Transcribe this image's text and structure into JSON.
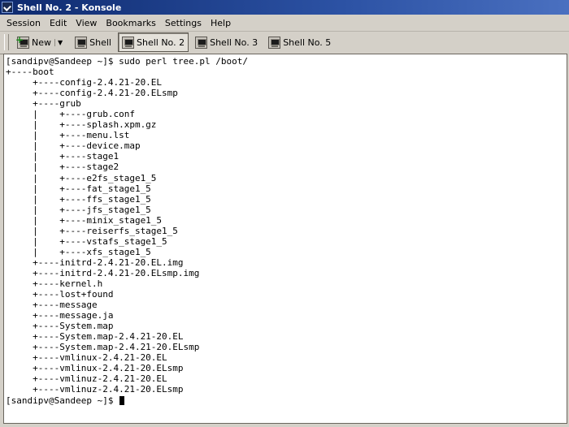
{
  "window": {
    "title": "Shell No. 2 - Konsole"
  },
  "menubar": [
    "Session",
    "Edit",
    "View",
    "Bookmarks",
    "Settings",
    "Help"
  ],
  "toolbar": {
    "new_label": "New",
    "tabs": [
      {
        "label": "Shell",
        "active": false
      },
      {
        "label": "Shell No. 2",
        "active": true
      },
      {
        "label": "Shell No. 3",
        "active": false
      },
      {
        "label": "Shell No. 5",
        "active": false
      }
    ]
  },
  "terminal": {
    "lines": [
      "[sandipv@Sandeep ~]$ sudo perl tree.pl /boot/",
      "+----boot",
      "     +----config-2.4.21-20.EL",
      "     +----config-2.4.21-20.ELsmp",
      "     +----grub",
      "     |    +----grub.conf",
      "     |    +----splash.xpm.gz",
      "     |    +----menu.lst",
      "     |    +----device.map",
      "     |    +----stage1",
      "     |    +----stage2",
      "     |    +----e2fs_stage1_5",
      "     |    +----fat_stage1_5",
      "     |    +----ffs_stage1_5",
      "     |    +----jfs_stage1_5",
      "     |    +----minix_stage1_5",
      "     |    +----reiserfs_stage1_5",
      "     |    +----vstafs_stage1_5",
      "     |    +----xfs_stage1_5",
      "     +----initrd-2.4.21-20.EL.img",
      "     +----initrd-2.4.21-20.ELsmp.img",
      "     +----kernel.h",
      "     +----lost+found",
      "     +----message",
      "     +----message.ja",
      "     +----System.map",
      "     +----System.map-2.4.21-20.EL",
      "     +----System.map-2.4.21-20.ELsmp",
      "     +----vmlinux-2.4.21-20.EL",
      "     +----vmlinux-2.4.21-20.ELsmp",
      "     +----vmlinuz-2.4.21-20.EL",
      "     +----vmlinuz-2.4.21-20.ELsmp"
    ],
    "prompt": "[sandipv@Sandeep ~]$ "
  }
}
